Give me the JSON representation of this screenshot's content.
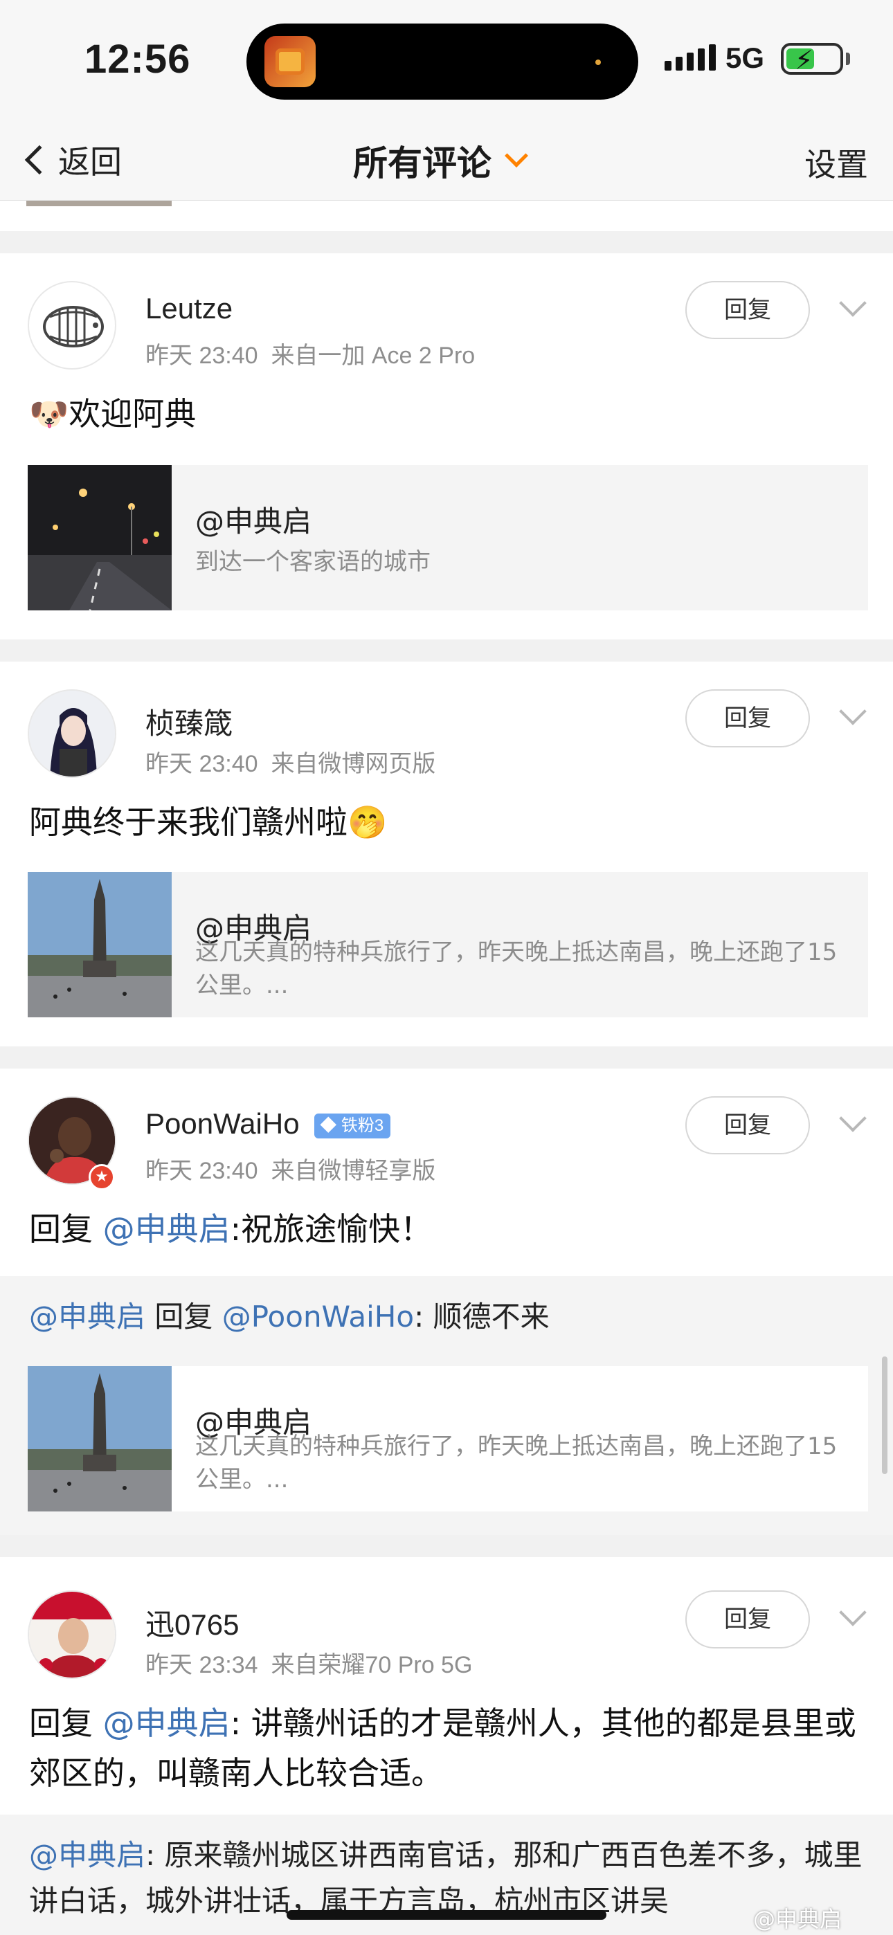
{
  "status_bar": {
    "time": "12:56",
    "network": "5G"
  },
  "nav": {
    "back_label": "返回",
    "title": "所有评论",
    "settings_label": "设置"
  },
  "comments": [
    {
      "username": "Leutze",
      "time": "昨天 23:40",
      "source": "来自一加 Ace 2 Pro",
      "reply_label": "回复",
      "emoji": "🐶",
      "text": "欢迎阿典",
      "card": {
        "title": "@申典启",
        "desc": "到达一个客家语的城市"
      }
    },
    {
      "username": "桢臻箴",
      "time": "昨天 23:40",
      "source": "来自微博网页版",
      "reply_label": "回复",
      "text": "阿典终于来我们赣州啦",
      "emoji": "🤭",
      "card": {
        "title": "@申典启",
        "desc": "这几天真的特种兵旅行了，昨天晚上抵达南昌，晚上还跑了15公里。..."
      }
    },
    {
      "username": "PoonWaiHo",
      "badge": "铁粉3",
      "time": "昨天 23:40",
      "source": "来自微博轻享版",
      "reply_label": "回复",
      "text_prefix": "回复 ",
      "text_mention": "@申典启",
      "text_rest": ":祝旅途愉快！",
      "quote": {
        "mention1": "@申典启",
        "middle": " 回复 ",
        "mention2": "@PoonWaiHo",
        "rest": ": 顺德不来"
      },
      "card": {
        "title": "@申典启",
        "desc": "这几天真的特种兵旅行了，昨天晚上抵达南昌，晚上还跑了15公里。..."
      }
    },
    {
      "username": "迅0765",
      "time": "昨天 23:34",
      "source": "来自荣耀70 Pro 5G",
      "reply_label": "回复",
      "text_prefix": "回复 ",
      "text_mention": "@申典启",
      "text_rest": ": 讲赣州话的才是赣州人，其他的都是县里或郊区的，叫赣南人比较合适。",
      "quote": {
        "mention1": "@申典启",
        "rest": ": 原来赣州城区讲西南官话，那和广西百色差不多，城里讲白话，城外讲壮话，属于方言岛，杭州市区讲吴"
      }
    }
  ],
  "watermark": "@申典启"
}
